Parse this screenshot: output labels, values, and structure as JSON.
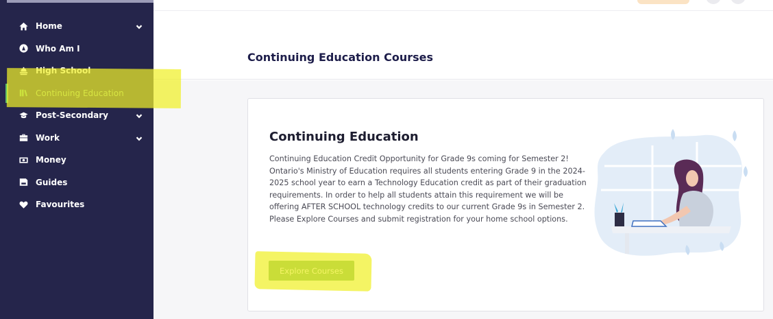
{
  "sidebar": {
    "items": [
      {
        "label": "Home",
        "icon": "home-icon",
        "has_chevron": true
      },
      {
        "label": "Who Am I",
        "icon": "user-circle-icon",
        "has_chevron": false
      },
      {
        "label": "High School",
        "icon": "school-bell-icon",
        "has_chevron": false
      },
      {
        "label": "Continuing Education",
        "icon": "books-icon",
        "has_chevron": false,
        "active": true
      },
      {
        "label": "Post-Secondary",
        "icon": "graduation-cap-icon",
        "has_chevron": true
      },
      {
        "label": "Work",
        "icon": "briefcase-icon",
        "has_chevron": true
      },
      {
        "label": "Money",
        "icon": "money-bill-icon",
        "has_chevron": false
      },
      {
        "label": "Guides",
        "icon": "guide-icon",
        "has_chevron": false
      },
      {
        "label": "Favourites",
        "icon": "heart-icon",
        "has_chevron": false
      }
    ]
  },
  "main": {
    "page_title": "Continuing Education Courses",
    "card": {
      "title": "Continuing Education",
      "description": "Continuing Education Credit Opportunity for Grade 9s coming for Semester 2! Ontario's Ministry of Education requires all students entering Grade 9 in the 2024-2025 school year to earn a Technology Education credit as part of their graduation requirements. In order to help all students attain this requirement we will be offering AFTER SCHOOL technology credits to our current Grade 9s in Semester 2. Please Explore Courses and submit registration for your home school options.",
      "button_label": "Explore Courses"
    }
  },
  "colors": {
    "sidebar_bg": "#25254b",
    "accent_green": "#6aac61",
    "highlight": "#f0f028",
    "title_navy": "#1d1d4a"
  }
}
